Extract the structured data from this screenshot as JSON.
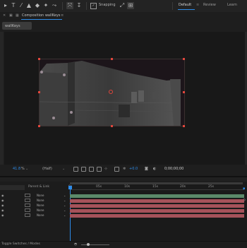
{
  "toolbar": {
    "snapping_label": "Snapping",
    "workspaces": [
      "Default",
      "Review",
      "Learn"
    ]
  },
  "composition": {
    "panel_title": "Composition wallKeys",
    "tab_label": "wallKeys"
  },
  "viewer_bar": {
    "zoom_value": "41.8",
    "zoom_unit": "%",
    "resolution": "(Half)",
    "exposure_value": "+0.0",
    "timecode": "0;00;00;00"
  },
  "timeline": {
    "parent_header": "Parent & Link",
    "ruler_ticks": [
      "0s",
      "05s",
      "10s",
      "15s",
      "20s",
      "25s"
    ],
    "layers": [
      {
        "parent": "None"
      },
      {
        "parent": "None"
      },
      {
        "parent": "None"
      },
      {
        "parent": "None"
      },
      {
        "parent": "None"
      }
    ],
    "footer_label": "Toggle Switches / Modes"
  },
  "colors": {
    "accent_blue": "#2d8ceb",
    "handle_red": "#e0463c",
    "bar_green": "#5b8a6a",
    "bar_red": "#a5525a"
  }
}
